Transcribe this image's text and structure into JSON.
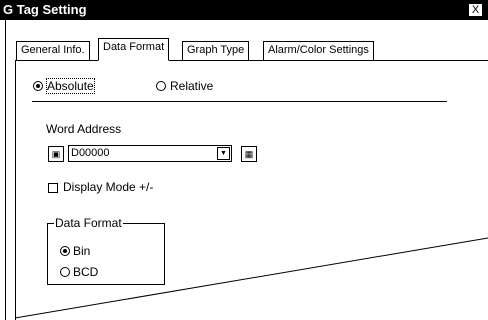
{
  "window": {
    "title": "G Tag Setting",
    "close_glyph": "X"
  },
  "tabs": [
    {
      "label": "General Info.",
      "active": false
    },
    {
      "label": "Data Format",
      "active": true
    },
    {
      "label": "Graph Type",
      "active": false
    },
    {
      "label": "Alarm/Color Settings",
      "active": false
    }
  ],
  "mode": {
    "absolute_label": "Absolute",
    "relative_label": "Relative",
    "selected": "Absolute"
  },
  "word_address": {
    "label": "Word Address",
    "value": "D00000"
  },
  "display_mode": {
    "label": "Display Mode +/-",
    "checked": false
  },
  "data_format": {
    "legend": "Data Format",
    "bin_label": "Bin",
    "bcd_label": "BCD",
    "selected": "Bin"
  },
  "icons": {
    "close": "close-icon",
    "device": "device-icon",
    "dropdown": "chevron-down-icon",
    "keypad": "keypad-icon"
  }
}
